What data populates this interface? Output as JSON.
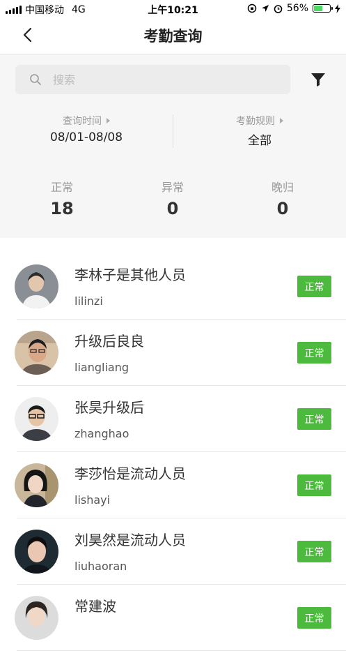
{
  "status_bar": {
    "carrier": "中国移动",
    "network": "4G",
    "time": "上午10:21",
    "battery": "56%",
    "battery_level": 0.56
  },
  "nav": {
    "title": "考勤查询"
  },
  "search": {
    "placeholder": "搜索"
  },
  "query": {
    "time_label": "查询时间",
    "time_value": "08/01-08/08",
    "rule_label": "考勤规则",
    "rule_value": "全部"
  },
  "stats": [
    {
      "label": "正常",
      "value": "18"
    },
    {
      "label": "异常",
      "value": "0"
    },
    {
      "label": "晚归",
      "value": "0"
    }
  ],
  "people": [
    {
      "name": "李林子是其他人员",
      "pinyin": "lilinzi",
      "status": "正常"
    },
    {
      "name": "升级后良良",
      "pinyin": "liangliang",
      "status": "正常"
    },
    {
      "name": "张昊升级后",
      "pinyin": "zhanghao",
      "status": "正常"
    },
    {
      "name": "李莎怡是流动人员",
      "pinyin": "lishayi",
      "status": "正常"
    },
    {
      "name": "刘昊然是流动人员",
      "pinyin": "liuhaoran",
      "status": "正常"
    },
    {
      "name": "常建波",
      "pinyin": "",
      "status": "正常"
    }
  ],
  "colors": {
    "status_green": "#4cba3c",
    "header_bg": "#f6f6f6"
  },
  "icons": {
    "back": "chevron-left-icon",
    "search": "search-icon",
    "filter": "filter-funnel-icon"
  }
}
